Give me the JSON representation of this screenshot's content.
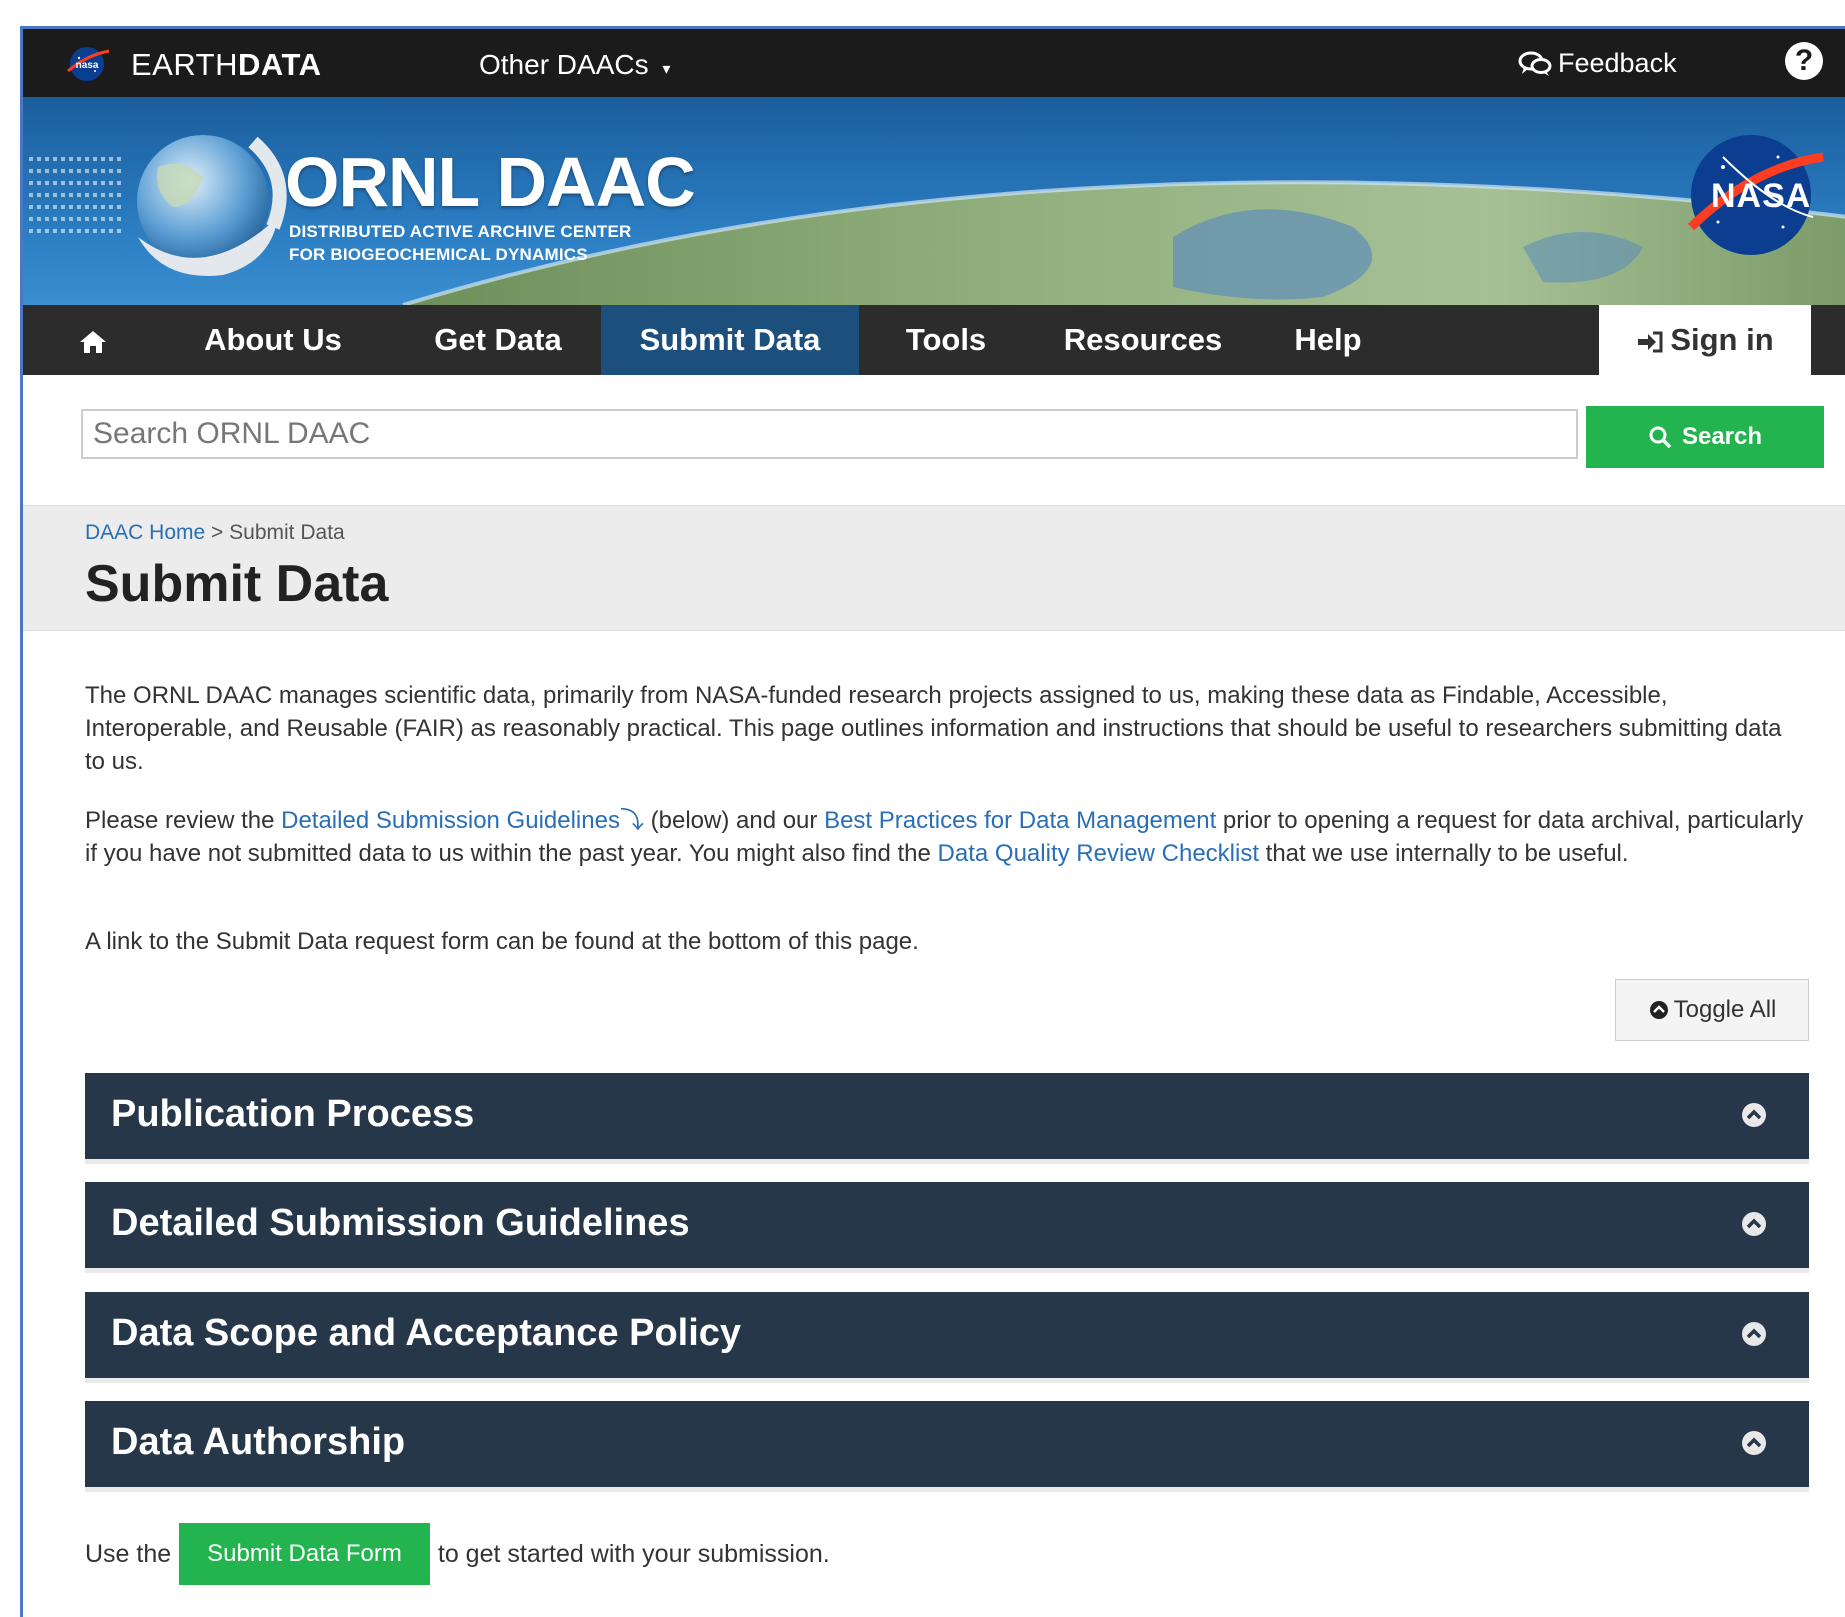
{
  "topbar": {
    "brand_light": "EARTH",
    "brand_bold": "DATA",
    "other_daacs": "Other DAACs",
    "other_daacs_caret": "▾",
    "feedback": "Feedback",
    "help": "?"
  },
  "banner": {
    "title": "ORNL DAAC",
    "subtitle_1": "DISTRIBUTED ACTIVE ARCHIVE CENTER",
    "subtitle_2": "FOR BIOGEOCHEMICAL DYNAMICS",
    "nasa": "NASA"
  },
  "nav": {
    "home_icon": "home-icon",
    "items": [
      "About Us",
      "Get Data",
      "Submit Data",
      "Tools",
      "Resources",
      "Help"
    ],
    "active": "Submit Data",
    "sign_in": "Sign in"
  },
  "search": {
    "placeholder": "Search ORNL DAAC",
    "button": "Search"
  },
  "breadcrumb": {
    "home": "DAAC Home",
    "separator": ">",
    "current": "Submit Data"
  },
  "page_title": "Submit Data",
  "content": {
    "p1": "The ORNL DAAC manages scientific data, primarily from NASA-funded research projects assigned to us, making these data as Findable, Accessible, Interoperable, and Reusable (FAIR) as reasonably practical. This page outlines information and instructions that should be useful to researchers submitting data to us.",
    "p2_a": "Please review the ",
    "p2_link1": "Detailed Submission Guidelines",
    "p2_link1_icon": "⤵",
    "p2_b": " (below) and our ",
    "p2_link2": "Best Practices for Data Management",
    "p2_c": " prior to opening a request for data archival, particularly if you have not submitted data to us within the past year. You might also find the ",
    "p2_link3": "Data Quality Review Checklist",
    "p2_d": " that we use internally to be useful.",
    "p3": "A link to the Submit Data request form can be found at the bottom of this page."
  },
  "toggle_all": "Toggle All",
  "accordion": [
    "Publication Process",
    "Detailed Submission Guidelines",
    "Data Scope and Acceptance Policy",
    "Data Authorship"
  ],
  "footer": {
    "before": "Use the",
    "button": "Submit Data Form",
    "after": "to get started with your submission."
  },
  "colors": {
    "topbar": "#1b1b1b",
    "nav": "#2c2c2c",
    "nav_active": "#1c4f7c",
    "accordion": "#253748",
    "green": "#23b34f",
    "link": "#2a6fb5"
  }
}
